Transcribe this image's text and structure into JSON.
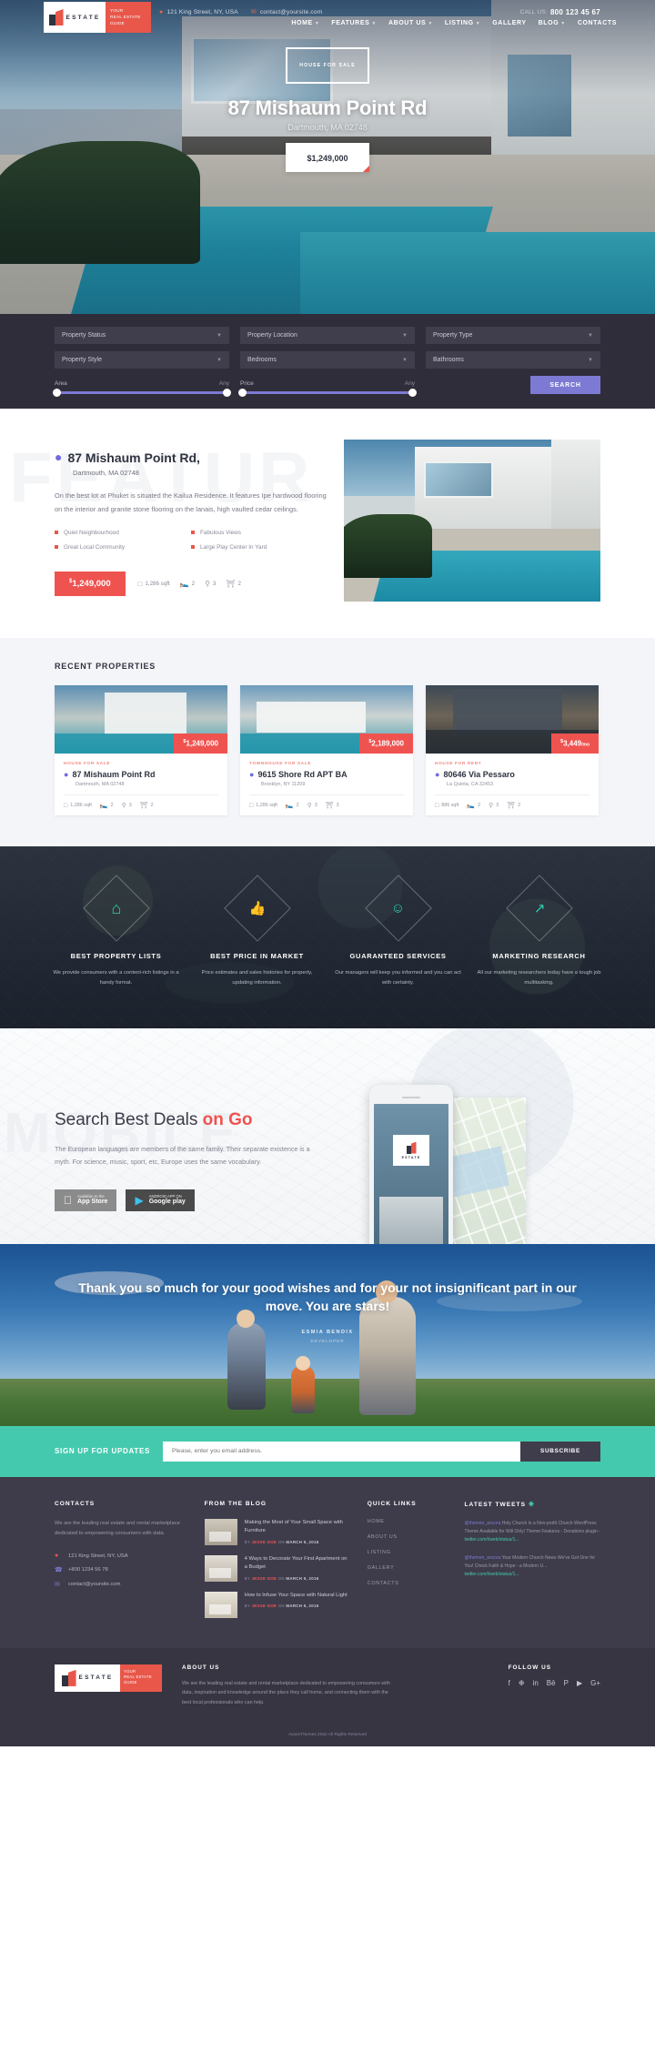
{
  "topbar": {
    "address": "121 King Street, NY, USA",
    "email": "contact@yoursite.com",
    "call_label": "CALL US:",
    "phone": "800 123 45 67",
    "pin_icon": "map-pin-icon",
    "mail_icon": "envelope-icon"
  },
  "logo": {
    "text": "ESTATE",
    "tagline": "YOUR\nREAL ESTATE\nGUIDE"
  },
  "nav": [
    {
      "label": "HOME",
      "caret": true
    },
    {
      "label": "FEATURES",
      "caret": true
    },
    {
      "label": "ABOUT US",
      "caret": true
    },
    {
      "label": "LISTING",
      "caret": true
    },
    {
      "label": "GALLERY",
      "caret": false
    },
    {
      "label": "BLOG",
      "caret": true
    },
    {
      "label": "CONTACTS",
      "caret": false
    }
  ],
  "hero": {
    "badge": "HOUSE FOR SALE",
    "title": "87 Mishaum Point Rd",
    "subtitle": "Dartmouth, MA 02748",
    "price": "$1,249,000"
  },
  "search": {
    "selects": [
      "Property Status",
      "Property Location",
      "Property Type",
      "Property Style",
      "Bedrooms",
      "Bathrooms"
    ],
    "sliders": [
      {
        "label": "Area",
        "value": "Any"
      },
      {
        "label": "Price",
        "value": "Any"
      }
    ],
    "button": "SEARCH"
  },
  "featured": {
    "ghost_word": "FEATUR",
    "title": "87 Mishaum Point Rd,",
    "address": "Dartmouth, MA 02748",
    "description": "On the best lot at Phuket is situated the Kailua Residence. It features Ipe hardwood flooring on the interior and granite stone flooring on the lanais, high vaulted cedar ceilings.",
    "bullets": [
      "Quiet Neighbourhood",
      "Fabulous Views",
      "Great Local Community",
      "Large Play Center In Yard"
    ],
    "price": "1,249,000",
    "price_currency": "$",
    "specs": [
      {
        "icon": "area-icon",
        "value": "1,286 sqft"
      },
      {
        "icon": "bed-icon",
        "value": "2"
      },
      {
        "icon": "bath-icon",
        "value": "3"
      },
      {
        "icon": "garage-icon",
        "value": "2"
      }
    ]
  },
  "recent": {
    "title": "RECENT PROPERTIES",
    "cards": [
      {
        "price": "1,249,000",
        "currency": "$",
        "kicker": "HOUSE FOR SALE",
        "name": "87 Mishaum Point Rd",
        "sub": "Dartmouth, MA 02748",
        "specs": [
          {
            "icon": "area-icon",
            "value": "1,286 sqft"
          },
          {
            "icon": "bed-icon",
            "value": "2"
          },
          {
            "icon": "bath-icon",
            "value": "3"
          },
          {
            "icon": "garage-icon",
            "value": "2"
          }
        ]
      },
      {
        "price": "2,189,000",
        "currency": "$",
        "kicker": "TOWNHOUSE FOR SALE",
        "name": "9615 Shore Rd APT BA",
        "sub": "Brooklyn, NY 11209",
        "specs": [
          {
            "icon": "area-icon",
            "value": "1,286 sqft"
          },
          {
            "icon": "bed-icon",
            "value": "2"
          },
          {
            "icon": "bath-icon",
            "value": "3"
          },
          {
            "icon": "garage-icon",
            "value": "3"
          }
        ]
      },
      {
        "price": "3,449",
        "currency": "$",
        "price_suffix": "/mo",
        "kicker": "HOUSE FOR RENT",
        "name": "80646 Via Pessaro",
        "sub": "La Quinta, CA 32453",
        "specs": [
          {
            "icon": "area-icon",
            "value": "886 sqft"
          },
          {
            "icon": "bed-icon",
            "value": "2"
          },
          {
            "icon": "bath-icon",
            "value": "3"
          },
          {
            "icon": "garage-icon",
            "value": "2"
          }
        ]
      }
    ]
  },
  "features": [
    {
      "icon": "home-outline-icon",
      "glyph": "⌂",
      "title": "BEST PROPERTY LISTS",
      "text": "We provide consumers with a content-rich listings in a handy format."
    },
    {
      "icon": "thumbs-up-icon",
      "glyph": "👍",
      "title": "BEST PRICE IN MARKET",
      "text": "Price estimates and sales histories for property, updating information."
    },
    {
      "icon": "user-shield-icon",
      "glyph": "☺",
      "title": "GUARANTEED SERVICES",
      "text": "Our managers will keep you informed and you can act with certainty."
    },
    {
      "icon": "chart-icon",
      "glyph": "↗",
      "title": "MARKETING RESEARCH",
      "text": "All our marketing researchers today have a tough job multitasking."
    }
  ],
  "mobile": {
    "ghost_word": "MOBILE",
    "heading_plain": "Search Best Deals ",
    "heading_accent": "on Go",
    "text": "The European languages are members of the same family. Their separate existence is a myth. For science, music, sport, etc, Europe uses the same vocabulary.",
    "stores": [
      {
        "small": "Available on the",
        "big": "App Store",
        "icon": "apple-icon",
        "glyph": ""
      },
      {
        "small": "ANDROID APP ON",
        "big": "Google play",
        "icon": "google-play-icon",
        "glyph": "▶"
      }
    ],
    "phone_logo": "ESTATE"
  },
  "testimonial": {
    "quote": "Thank you so much for your good wishes and for your not insignificant part in our move. You are stars!",
    "author": "ESMIA BENDIX",
    "role": "DEVELOPER"
  },
  "subscribe": {
    "heading": "SIGN UP FOR UPDATES",
    "placeholder": "Please, enter you email address.",
    "button": "SUBSCRIBE"
  },
  "footer": {
    "contacts": {
      "heading": "CONTACTS",
      "text": "We are the leading real estate and rental marketplace dedicated to empowering consumers with data.",
      "address": "121 King Street, NY, USA",
      "phone": "+800 1234 56 78",
      "email": "contact@yoursite.com",
      "pin_icon": "map-pin-icon",
      "phone_icon": "phone-icon",
      "mail_icon": "envelope-icon"
    },
    "blog": {
      "heading": "FROM THE BLOG",
      "posts": [
        {
          "title": "Making the Most of Your Small Space with Furniture",
          "by": "BY",
          "author": "JESSE DOE",
          "on": "ON",
          "date": "MARCH 9, 2016"
        },
        {
          "title": "4 Ways to Decorate Your First Apartment on a Budget",
          "by": "BY",
          "author": "JESSE DOE",
          "on": "ON",
          "date": "MARCH 9, 2016"
        },
        {
          "title": "How to Infuse Your Space with Natural Light",
          "by": "BY",
          "author": "JESSE DOE",
          "on": "ON",
          "date": "MARCH 9, 2016"
        }
      ]
    },
    "quicklinks": {
      "heading": "QUICK LINKS",
      "links": [
        "HOME",
        "ABOUT US",
        "LISTING",
        "GALLERY",
        "CONTACTS"
      ]
    },
    "tweets": {
      "heading": "LATEST TWEETS",
      "twitter_icon": "twitter-icon",
      "items": [
        {
          "handle": "@themen_ancora",
          "text": " Holy Church Is a Non-profit Church WordPress Theme Available for Will Only! Theme Features - Donations plugin - ",
          "link": "twitter.com/i/web/status/1..."
        },
        {
          "handle": "@themen_ancora",
          "text": " Your Modern Church News We've Got One for You! Check Faith & Hope - a Modern U... ",
          "link": "twitter.com/i/web/status/1..."
        }
      ]
    },
    "bottom": {
      "logo": "ESTATE",
      "logo_tagline": "YOUR\nREAL ESTATE\nGUIDE",
      "about_heading": "ABOUT US",
      "about_text": "We are the leading real estate and rental marketplace dedicated to empowering consumers with data, inspiration and knowledge around the place they call home, and connecting them with the best local professionals who can help.",
      "follow_heading": "FOLLOW US",
      "socials": [
        {
          "icon": "facebook-icon",
          "glyph": "f"
        },
        {
          "icon": "twitter-icon",
          "glyph": "✉"
        },
        {
          "icon": "linkedin-icon",
          "glyph": "in"
        },
        {
          "icon": "behance-icon",
          "glyph": "Bē"
        },
        {
          "icon": "pinterest-icon",
          "glyph": "P"
        },
        {
          "icon": "youtube-icon",
          "glyph": "▶"
        },
        {
          "icon": "google-plus-icon",
          "glyph": "G+"
        }
      ],
      "copyright": "AxiomThemes  2022 All Rights Reserved"
    }
  },
  "colors": {
    "accent_red": "#ef5350",
    "accent_purple": "#7d7ad4",
    "accent_teal": "#45c9ae",
    "dark": "#2f2d3a",
    "footer": "#3e3c4b"
  }
}
